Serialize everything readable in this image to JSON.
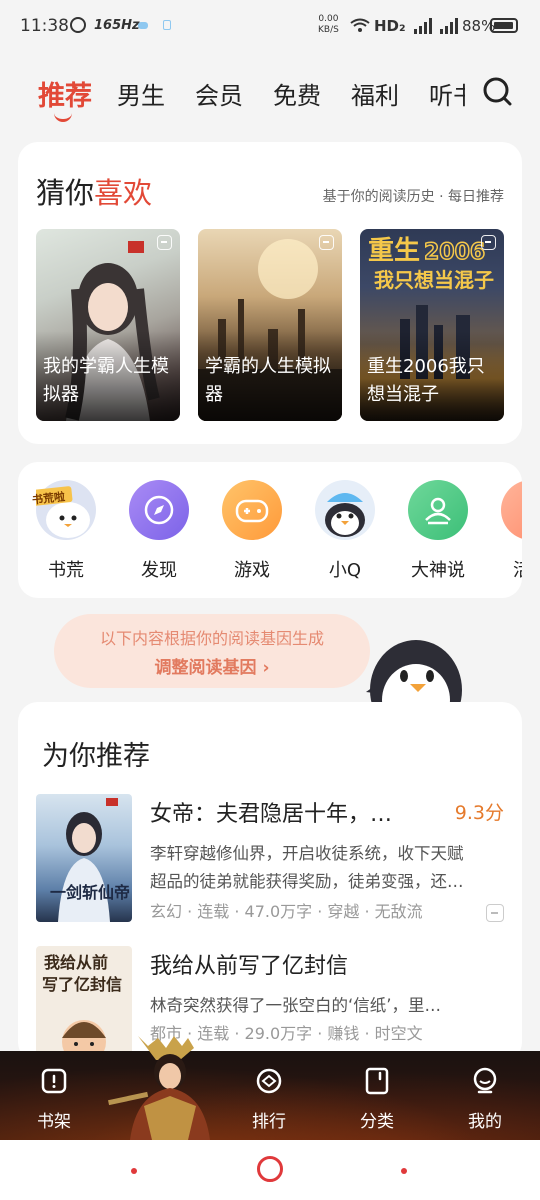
{
  "status": {
    "time": "11:38",
    "hz": "165Hz",
    "speed_value": "0.00",
    "speed_unit": "KB/S",
    "hd": "HD₂",
    "battery": "88%"
  },
  "tabs": [
    {
      "label": "推荐",
      "active": true
    },
    {
      "label": "男生"
    },
    {
      "label": "会员"
    },
    {
      "label": "免费"
    },
    {
      "label": "福利"
    },
    {
      "label": "听书"
    }
  ],
  "guess": {
    "title_plain": "猜你",
    "title_highlight": "喜欢",
    "subtitle": "基于你的阅读历史 · 每日推荐",
    "books": [
      {
        "title": "我的学霸人生模拟器"
      },
      {
        "title": "学霸的人生模拟器"
      },
      {
        "title": "重生2006我只想当混子"
      }
    ]
  },
  "shortcuts": [
    {
      "label": "书荒",
      "icon": "book-shortage-icon",
      "badge": "书荒啦"
    },
    {
      "label": "发现",
      "icon": "compass-icon"
    },
    {
      "label": "游戏",
      "icon": "gamepad-icon"
    },
    {
      "label": "小Q",
      "icon": "penguin-mascot-icon"
    },
    {
      "label": "大神说",
      "icon": "author-talk-icon"
    },
    {
      "label": "活动",
      "icon": "event-icon"
    }
  ],
  "gene_banner": {
    "line1": "以下内容根据你的阅读基因生成",
    "line2": "调整阅读基因 ›"
  },
  "recommend": {
    "title": "为你推荐",
    "items": [
      {
        "title": "女帝：夫君隐居十年，…",
        "score": "9.3分",
        "desc1": "李轩穿越修仙界，开启收徒系统，收下天赋",
        "desc2": "超品的徒弟就能获得奖励，徒弟变强，还…",
        "tags": "玄幻 · 连载 · 47.0万字 · 穿越 · 无敌流"
      },
      {
        "title": "我给从前写了亿封信",
        "score": "",
        "desc1": "林奇突然获得了一张空白的‘信纸’，里…",
        "desc2": "",
        "tags": "都市 · 连载 · 29.0万字 · 赚钱 · 时空文"
      }
    ]
  },
  "bottom_nav": [
    {
      "label": "书架",
      "icon": "bookshelf-icon"
    },
    {
      "label": "排行",
      "icon": "ranking-icon"
    },
    {
      "label": "分类",
      "icon": "category-icon"
    },
    {
      "label": "我的",
      "icon": "profile-icon"
    }
  ],
  "colors": {
    "accent": "#e24937",
    "score": "#e57a2c"
  }
}
